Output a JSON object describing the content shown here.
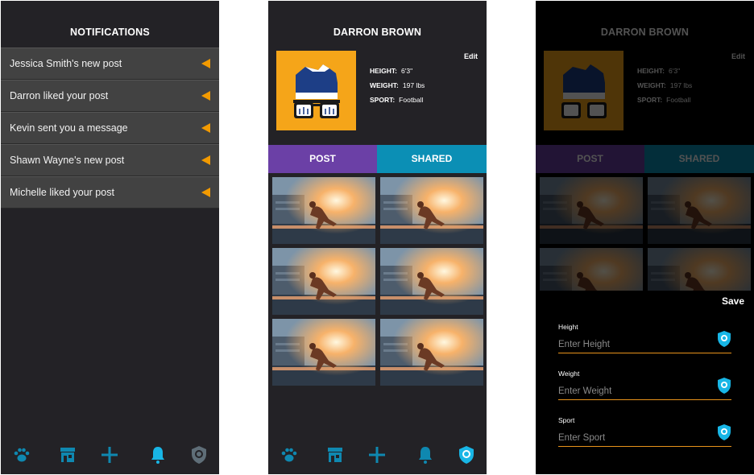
{
  "notifications_screen": {
    "title": "NOTIFICATIONS",
    "items": [
      {
        "text": "Jessica Smith's new post"
      },
      {
        "text": "Darron liked your post"
      },
      {
        "text": "Kevin sent you a message"
      },
      {
        "text": "Shawn Wayne's new post"
      },
      {
        "text": "Michelle liked your post"
      }
    ]
  },
  "profile_screen": {
    "title": "DARRON BROWN",
    "edit_label": "Edit",
    "stats": [
      {
        "label": "HEIGHT:",
        "value": "6'3\""
      },
      {
        "label": "WEIGHT:",
        "value": "197 lbs"
      },
      {
        "label": "SPORT:",
        "value": "Football"
      }
    ],
    "tabs": {
      "post": "POST",
      "shared": "SHARED"
    }
  },
  "edit_sheet": {
    "save_label": "Save",
    "fields": [
      {
        "label": "Height",
        "placeholder": "Enter Height"
      },
      {
        "label": "Weight",
        "placeholder": "Enter Weight"
      },
      {
        "label": "Sport",
        "placeholder": "Enter Sport"
      }
    ]
  },
  "nav_icons": [
    "paw-icon",
    "store-icon",
    "plus-icon",
    "bell-icon",
    "lion-shield-icon"
  ],
  "colors": {
    "accent_orange": "#f29a00",
    "post_tab": "#6b40a6",
    "shared_tab": "#0b8fb5",
    "nav_blue": "#0f88b0",
    "nav_active": "#18b6e6"
  }
}
